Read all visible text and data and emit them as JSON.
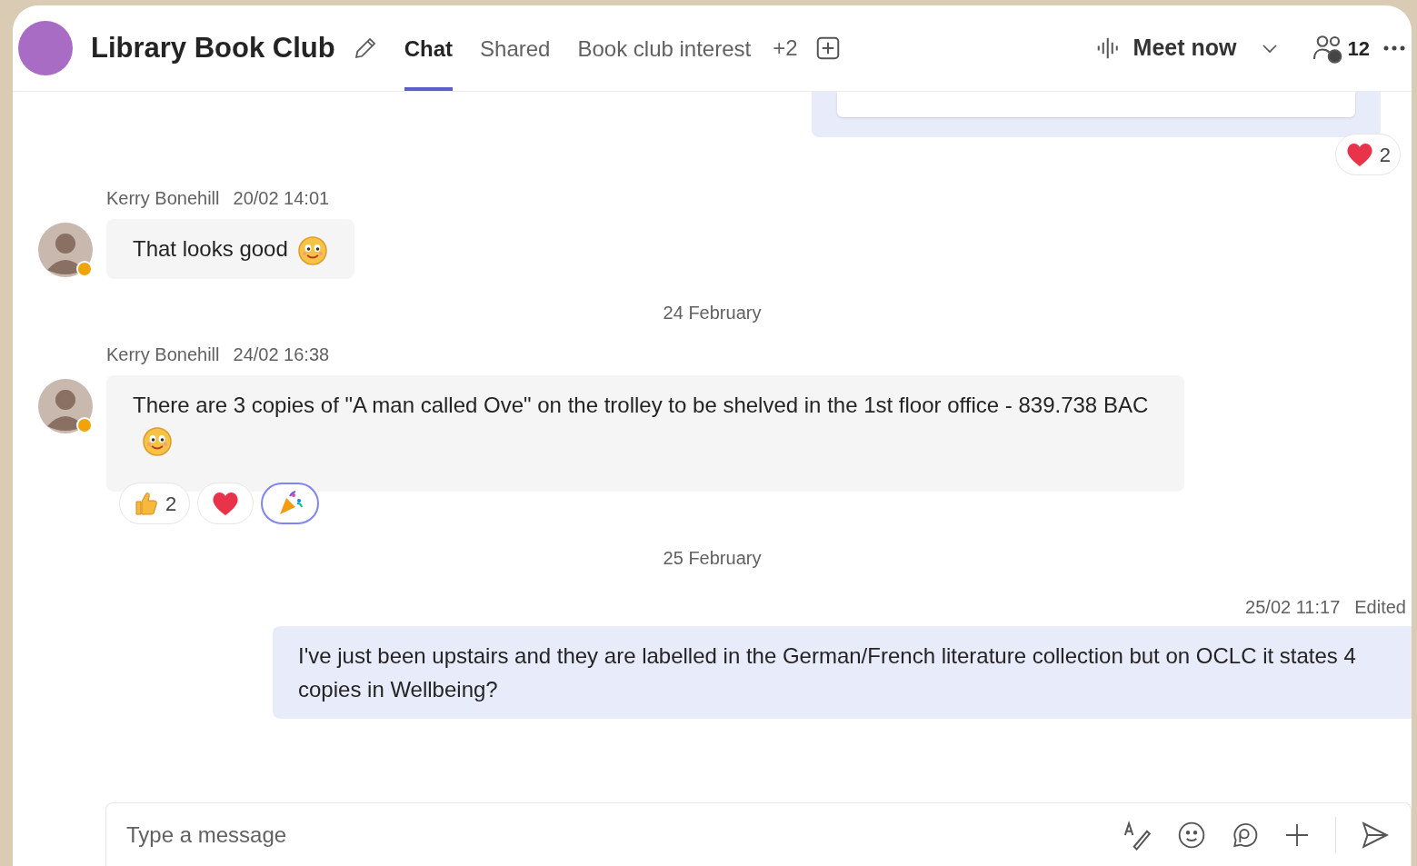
{
  "header": {
    "title": "Library Book Club",
    "tabs": [
      {
        "label": "Chat",
        "selected": true
      },
      {
        "label": "Shared",
        "selected": false
      },
      {
        "label": "Book club interest",
        "selected": false
      }
    ],
    "more_tabs": "+2",
    "meet_button": "Meet now",
    "participants": "12"
  },
  "top_reaction": {
    "count": "2"
  },
  "messages": [
    {
      "kind": "incoming",
      "author": "Kerry Bonehill",
      "time": "20/02 14:01",
      "color": "#f0a30a",
      "text": "That looks good",
      "emoji": true
    },
    {
      "kind": "date",
      "text": "24 February"
    },
    {
      "kind": "incoming",
      "author": "Kerry Bonehill",
      "time": "24/02 16:38",
      "color": "#f0a30a",
      "text": "There are 3 copies of \"A man called Ove\" on the trolley to be shelved in the 1st floor office - 839.738 BAC",
      "emoji": true,
      "reactions": [
        {
          "kind": "thumbs",
          "count": "2",
          "selected": false
        },
        {
          "kind": "heart",
          "selected": false
        },
        {
          "kind": "party",
          "selected": true
        }
      ]
    },
    {
      "kind": "date",
      "text": "25 February"
    },
    {
      "kind": "outgoing",
      "time": "25/02 11:17",
      "edited": "Edited",
      "text": "I've just been upstairs and they are labelled in the German/French literature collection but on OCLC it states 4 copies in Wellbeing?"
    }
  ],
  "composer": {
    "placeholder": "Type a message"
  }
}
